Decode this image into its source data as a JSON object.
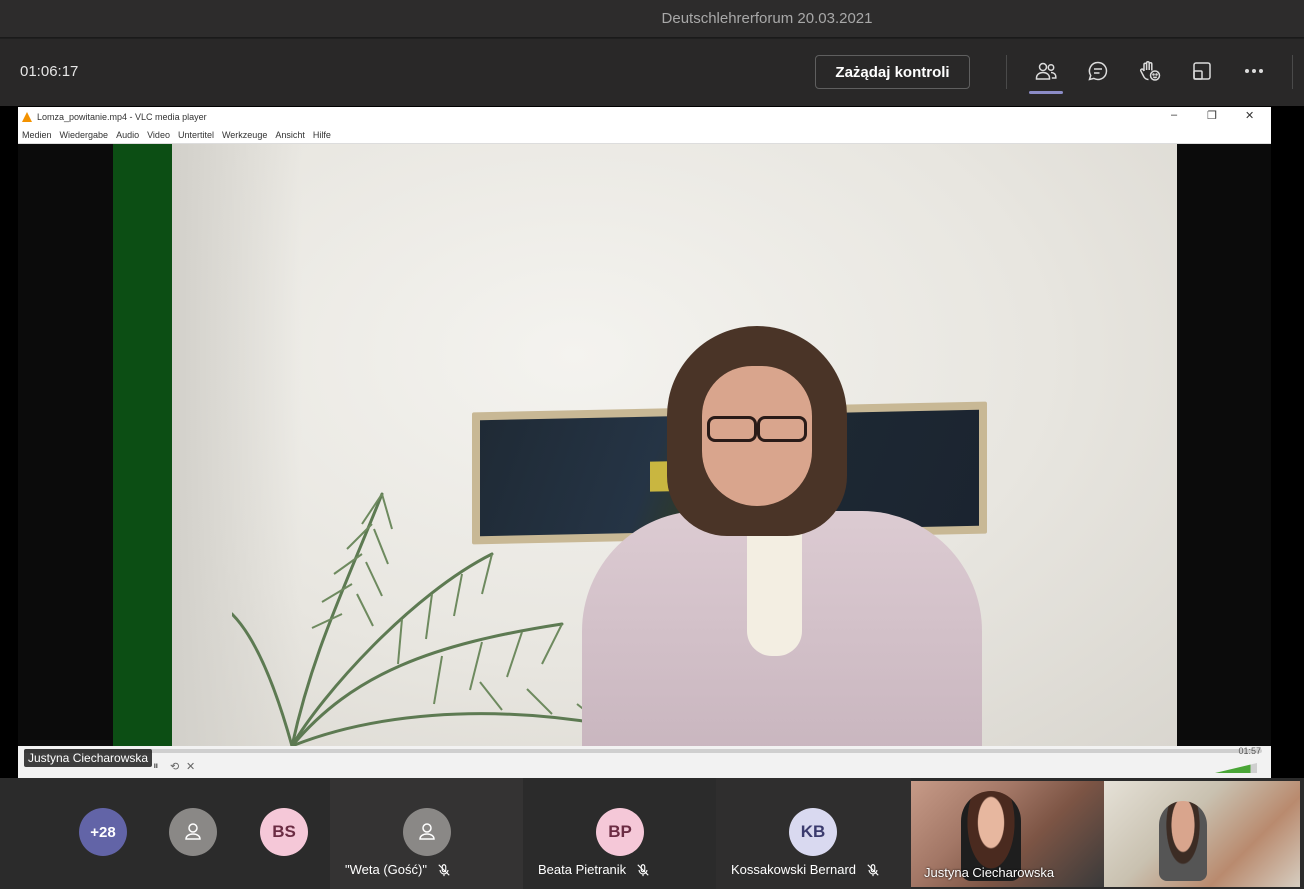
{
  "meeting": {
    "title": "Deutschlehrerforum 20.03.2021",
    "elapsed_time": "01:06:17",
    "request_control_label": "Zażądaj kontroli"
  },
  "toolbar_icons": [
    {
      "name": "people-icon",
      "active": true
    },
    {
      "name": "chat-icon",
      "active": false
    },
    {
      "name": "reactions-icon",
      "active": false
    },
    {
      "name": "view-layout-icon",
      "active": false
    },
    {
      "name": "more-options-icon",
      "active": false
    }
  ],
  "shared_window": {
    "title": "Lomza_powitanie.mp4 - VLC media player",
    "menu": [
      "Medien",
      "Wiedergabe",
      "Audio",
      "Video",
      "Untertitel",
      "Werkzeuge",
      "Ansicht",
      "Hilfe"
    ],
    "time_right": "01:57",
    "presenter_name": "Justyna Ciecharowska"
  },
  "participants": {
    "overflow_count": "+28",
    "bs_initials": "BS",
    "tiles": [
      {
        "name": "\"Weta (Gość)\"",
        "initials": "",
        "muted": true
      },
      {
        "name": "Beata Pietranik",
        "initials": "BP",
        "muted": true
      },
      {
        "name": "Kossakowski Bernard",
        "initials": "KB",
        "muted": true
      }
    ],
    "video_tiles": [
      {
        "name": "Justyna Ciecharowska"
      },
      {
        "name": ""
      }
    ]
  },
  "colors": {
    "accent": "#6264a7",
    "background": "#1f1f1f",
    "toolbar": "#292828"
  }
}
